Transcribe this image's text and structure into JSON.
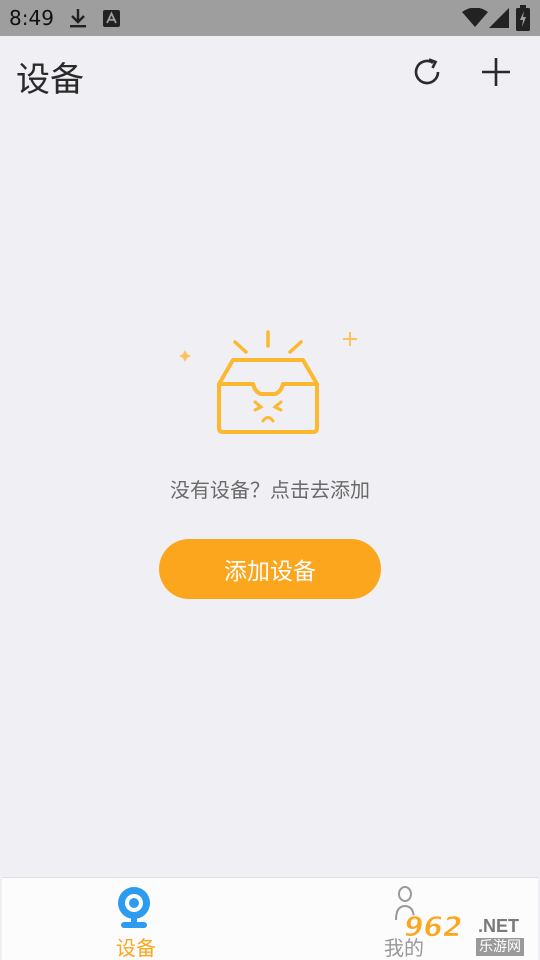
{
  "status_bar": {
    "time": "8:49",
    "icons": [
      "download-icon",
      "notification-a-icon",
      "wifi-icon",
      "signal-icon",
      "battery-icon"
    ]
  },
  "header": {
    "title": "设备",
    "actions": [
      "refresh-icon",
      "add-icon"
    ]
  },
  "empty_state": {
    "illustration": "empty-box-icon",
    "message": "没有设备？点击去添加",
    "button_label": "添加设备"
  },
  "tab_bar": {
    "tabs": [
      {
        "label": "设备",
        "icon": "camera-icon",
        "active": true
      },
      {
        "label": "我的",
        "icon": "person-icon",
        "active": false
      }
    ]
  },
  "watermark": {
    "logo": "962",
    "suffix": ".NET",
    "subtitle": "乐游网"
  },
  "colors": {
    "accent": "#fca61e",
    "tab_active_icon": "#2d9cf0",
    "background": "#f0eff4",
    "status_bar": "#9e9e9e"
  }
}
